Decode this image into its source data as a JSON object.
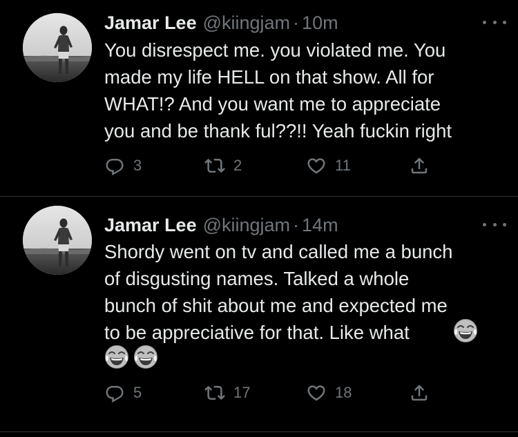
{
  "colors": {
    "background": "#000000",
    "text_primary": "#e7e9ea",
    "text_secondary": "#71767b",
    "divider": "#2f3336"
  },
  "tweets": [
    {
      "author_name": "Jamar Lee",
      "handle": "@kiingjam",
      "separator": "·",
      "time": "10m",
      "avatar_icon": "profile-photo-avatar",
      "text": "You disrespect me. you violated me. You\nmade my life HELL on that show. All for\nWHAT!? And you want me to appreciate\nyou and be thank ful??!! Yeah fuckin right",
      "emoji": [],
      "actions": {
        "reply_count": "3",
        "retweet_count": "2",
        "like_count": "11"
      }
    },
    {
      "author_name": "Jamar Lee",
      "handle": "@kiingjam",
      "separator": "·",
      "time": "14m",
      "avatar_icon": "profile-photo-avatar",
      "text": "Shordy went on tv and called me a bunch\nof disgusting names. Talked a whole\nbunch of shit about me and expected me\nto be appreciative for that. Like what",
      "emoji": [
        "face-with-tears-of-joy",
        "face-with-tears-of-joy",
        "face-with-tears-of-joy"
      ],
      "actions": {
        "reply_count": "5",
        "retweet_count": "17",
        "like_count": "18"
      }
    }
  ]
}
